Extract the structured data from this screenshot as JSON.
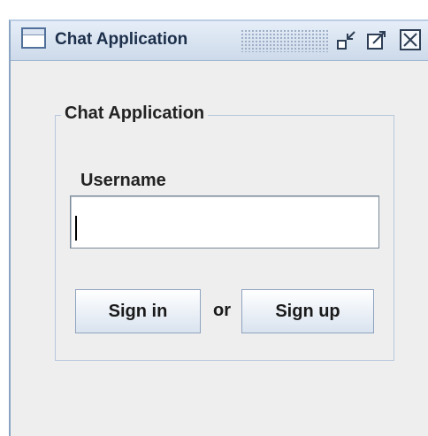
{
  "window": {
    "title": "Chat Application",
    "controls": {
      "minimize": "minimize-icon",
      "maximize": "maximize-icon",
      "close": "close-icon"
    }
  },
  "form": {
    "group_title": "Chat Application",
    "username_label": "Username",
    "username_value": "",
    "or_text": "or",
    "sign_in_label": "Sign in",
    "sign_up_label": "Sign up"
  },
  "colors": {
    "window_bg": "#eeeeee",
    "titlebar": "#cddaea",
    "group_border": "#b8c8dc"
  }
}
